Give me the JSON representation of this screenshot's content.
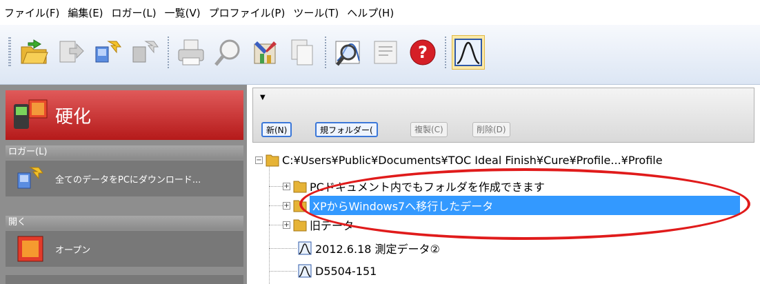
{
  "menu": [
    "ファイル(F)",
    "編集(E)",
    "ロガー(L)",
    "一覧(V)",
    "プロファイル(P)",
    "ツール(T)",
    "ヘルプ(H)"
  ],
  "sidebar": {
    "title": "硬化",
    "sections": [
      {
        "label": "ロガー(L)",
        "item": "全てのデータをPCにダウンロード..."
      },
      {
        "label": "開く",
        "item": "オープン"
      }
    ]
  },
  "panel": {
    "buttons": {
      "new": "新(N)",
      "new_folder": "規フォルダー(",
      "duplicate": "複製(C)",
      "delete": "削除(D)"
    }
  },
  "tree": {
    "root": "C:¥Users¥Public¥Documents¥TOC Ideal Finish¥Cure¥Profile...¥Profile",
    "folders": [
      "PCドキュメント内でもフォルダを作成できます",
      "XPからWindows7へ移行したデータ",
      "旧データ"
    ],
    "profiles": [
      "2012.6.18 測定データ②",
      "D5504-151"
    ]
  },
  "colors": {
    "sidebar_header": "#c0282a",
    "selection": "#3399ff",
    "annotation_ellipse": "#e01b1b"
  },
  "icons": [
    "open-folder-icon",
    "export-icon",
    "download-icon",
    "upload-icon",
    "print-icon",
    "zoom-icon",
    "tools-icon",
    "copy-icon",
    "search-chart-icon",
    "notes-icon",
    "help-icon",
    "profile-curve-icon"
  ]
}
